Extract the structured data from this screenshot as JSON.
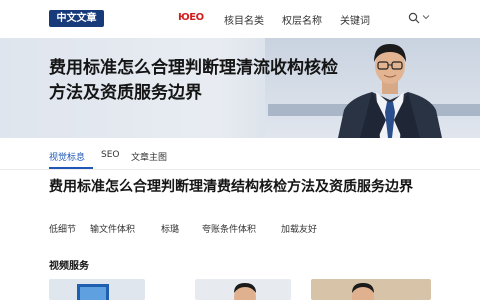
{
  "header": {
    "logo_text": "中文文章",
    "brand_text": "ЮEO",
    "nav": [
      "核目名类",
      "权层名称",
      "关键词"
    ],
    "search_icon": "search-icon",
    "dropdown_icon": "chevron-down-icon"
  },
  "hero": {
    "title": "费用标准怎么合理判断理清流收构核检方法及资质服务边界"
  },
  "tabs": {
    "items": [
      "视觉标息",
      "SEO",
      "文章主图"
    ],
    "active_index": 0
  },
  "article": {
    "title": "费用标准怎么合理判断理清费结构核检方法及资质服务边界",
    "tags": [
      "低细节",
      "输文件体积",
      "标璐",
      "夸账条件体积",
      "加载友好"
    ]
  },
  "section": {
    "title": "视频服务"
  },
  "colors": {
    "brand_red": "#d21f1f",
    "logo_bg": "#163a7a",
    "active_tab": "#1e57b8"
  }
}
